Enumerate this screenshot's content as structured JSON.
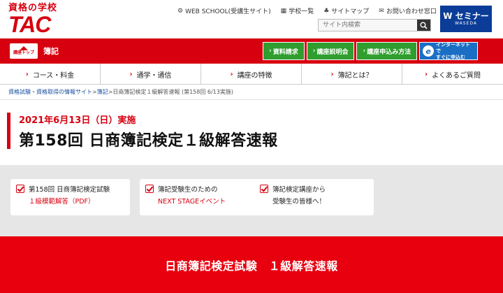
{
  "logo": {
    "top": "資格の学校",
    "main": "TAC"
  },
  "util_links": [
    {
      "icon": "gear-icon",
      "label": "WEB SCHOOL(受講生サイト)"
    },
    {
      "icon": "building-icon",
      "label": "学校一覧"
    },
    {
      "icon": "sitemap-icon",
      "label": "サイトマップ"
    },
    {
      "icon": "mail-icon",
      "label": "お問い合わせ窓口"
    }
  ],
  "search": {
    "placeholder": "サイト内検索"
  },
  "wseminar": {
    "label": "W セミナー",
    "sub": "WASEDA"
  },
  "redband": {
    "course_top": "講座トップ",
    "title": "簿記",
    "buttons": [
      "資料請求",
      "講座説明会",
      "講座申込み方法"
    ],
    "internet_button": [
      "インターネットで",
      "すぐに申込む"
    ]
  },
  "nav": [
    "コース・料金",
    "通学・通信",
    "講座の特徴",
    "簿記とは？",
    "よくあるご質問"
  ],
  "breadcrumb": {
    "link1": "資格試験・資格取得の情報サイト",
    "sep": ">",
    "link2": "簿記",
    "current": "日商簿記検定１級解答速報 (第158回 6/13実施)"
  },
  "title": {
    "date": "2021年6月13日（日）実施",
    "main": "第158回 日商簿記検定１級解答速報"
  },
  "cards": [
    {
      "line1": "第158回 日商簿記検定試験",
      "line2": "１級模範解答（PDF）"
    },
    {
      "line1": "簿記受験生のための",
      "line2": "NEXT STAGEイベント"
    },
    {
      "line1": "簿記検定講座から",
      "line2": "受験生の皆様へ！"
    }
  ],
  "banner": "日商簿記検定試験　１級解答速報",
  "colors": {
    "brand_red": "#d6000f",
    "green": "#2f9e2f",
    "blue": "#1a6fc4",
    "navy": "#0a3c98"
  }
}
